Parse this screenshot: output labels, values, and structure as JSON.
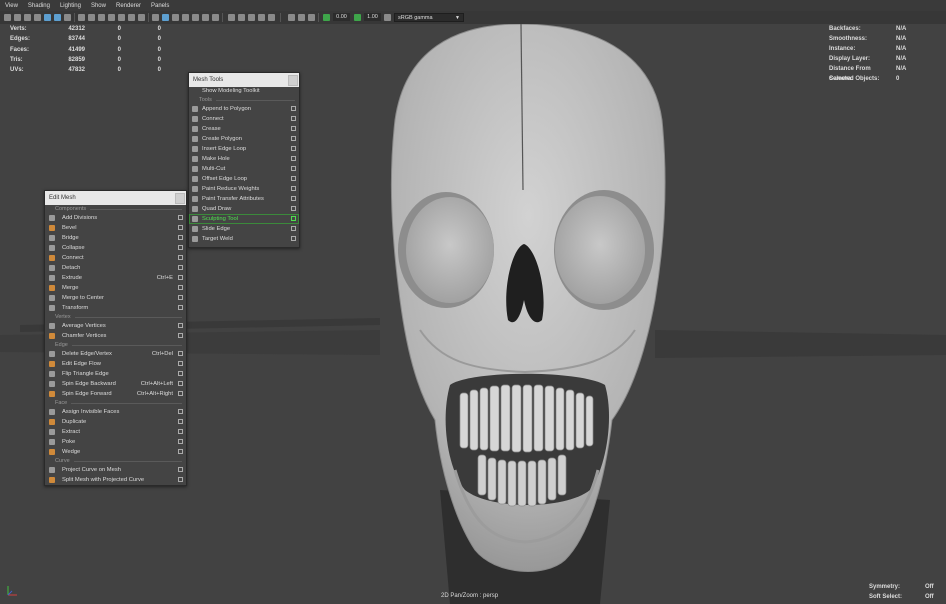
{
  "menubar": [
    "View",
    "Shading",
    "Lighting",
    "Show",
    "Renderer",
    "Panels"
  ],
  "toolbar": {
    "value1": "0.00",
    "value2": "1.00",
    "color_space": "sRGB gamma"
  },
  "stats": [
    {
      "label": "Verts:",
      "v1": "42312",
      "v2": "0",
      "v3": "0"
    },
    {
      "label": "Edges:",
      "v1": "83744",
      "v2": "0",
      "v3": "0"
    },
    {
      "label": "Faces:",
      "v1": "41499",
      "v2": "0",
      "v3": "0"
    },
    {
      "label": "Tris:",
      "v1": "82859",
      "v2": "0",
      "v3": "0"
    },
    {
      "label": "UVs:",
      "v1": "47832",
      "v2": "0",
      "v3": "0"
    }
  ],
  "hud": [
    {
      "label": "Backfaces:",
      "value": "N/A"
    },
    {
      "label": "Smoothness:",
      "value": "N/A"
    },
    {
      "label": "Instance:",
      "value": "N/A"
    },
    {
      "label": "Display Layer:",
      "value": "N/A"
    },
    {
      "label": "Distance From Camera:",
      "value": "N/A"
    },
    {
      "label": "Selected Objects:",
      "value": "0"
    }
  ],
  "hud_bottom": [
    {
      "label": "Symmetry:",
      "value": "Off"
    },
    {
      "label": "Soft Select:",
      "value": "Off"
    }
  ],
  "camera_label": "2D Pan/Zoom : persp",
  "mesh_tools": {
    "title": "Mesh Tools",
    "toolkit": "Show Modeling Toolkit",
    "section": "Tools",
    "items": [
      {
        "label": "Append to Polygon",
        "icon": "append-polygon-icon"
      },
      {
        "label": "Connect",
        "icon": "connect-icon"
      },
      {
        "label": "Crease",
        "icon": "crease-icon"
      },
      {
        "label": "Create Polygon",
        "icon": "create-polygon-icon"
      },
      {
        "label": "Insert Edge Loop",
        "icon": "insert-edge-loop-icon"
      },
      {
        "label": "Make Hole",
        "icon": "make-hole-icon"
      },
      {
        "label": "Multi-Cut",
        "icon": "multi-cut-icon"
      },
      {
        "label": "Offset Edge Loop",
        "icon": "offset-edge-loop-icon"
      },
      {
        "label": "Paint Reduce Weights",
        "icon": "paint-reduce-icon"
      },
      {
        "label": "Paint Transfer Attributes",
        "icon": "paint-transfer-icon"
      },
      {
        "label": "Quad Draw",
        "icon": "quad-draw-icon"
      },
      {
        "label": "Sculpting Tool",
        "icon": "sculpting-icon",
        "active": true
      },
      {
        "label": "Slide Edge",
        "icon": "slide-edge-icon"
      },
      {
        "label": "Target Weld",
        "icon": "target-weld-icon"
      }
    ]
  },
  "edit_mesh": {
    "title": "Edit Mesh",
    "sections": [
      {
        "name": "Components",
        "items": [
          {
            "label": "Add Divisions",
            "shortcut": ""
          },
          {
            "label": "Bevel",
            "shortcut": ""
          },
          {
            "label": "Bridge",
            "shortcut": ""
          },
          {
            "label": "Collapse",
            "shortcut": ""
          },
          {
            "label": "Connect",
            "shortcut": ""
          },
          {
            "label": "Detach",
            "shortcut": ""
          },
          {
            "label": "Extrude",
            "shortcut": "Ctrl+E"
          },
          {
            "label": "Merge",
            "shortcut": ""
          },
          {
            "label": "Merge to Center",
            "shortcut": ""
          },
          {
            "label": "Transform",
            "shortcut": ""
          }
        ]
      },
      {
        "name": "Vertex",
        "items": [
          {
            "label": "Average Vertices",
            "shortcut": ""
          },
          {
            "label": "Chamfer Vertices",
            "shortcut": ""
          }
        ]
      },
      {
        "name": "Edge",
        "items": [
          {
            "label": "Delete Edge/Vertex",
            "shortcut": "Ctrl+Del"
          },
          {
            "label": "Edit Edge Flow",
            "shortcut": ""
          },
          {
            "label": "Flip Triangle Edge",
            "shortcut": ""
          },
          {
            "label": "Spin Edge Backward",
            "shortcut": "Ctrl+Alt+Left"
          },
          {
            "label": "Spin Edge Forward",
            "shortcut": "Ctrl+Alt+Right"
          }
        ]
      },
      {
        "name": "Face",
        "items": [
          {
            "label": "Assign Invisible Faces",
            "shortcut": ""
          },
          {
            "label": "Duplicate",
            "shortcut": ""
          },
          {
            "label": "Extract",
            "shortcut": ""
          },
          {
            "label": "Poke",
            "shortcut": ""
          },
          {
            "label": "Wedge",
            "shortcut": ""
          }
        ]
      },
      {
        "name": "Curve",
        "items": [
          {
            "label": "Project Curve on Mesh",
            "shortcut": ""
          },
          {
            "label": "Split Mesh with Projected Curve",
            "shortcut": ""
          }
        ]
      }
    ]
  },
  "colors": {
    "accent": "#5d9fd0",
    "active": "#4fe04f",
    "viewport_bg": "#424242",
    "skull": "#bdbdbd"
  }
}
